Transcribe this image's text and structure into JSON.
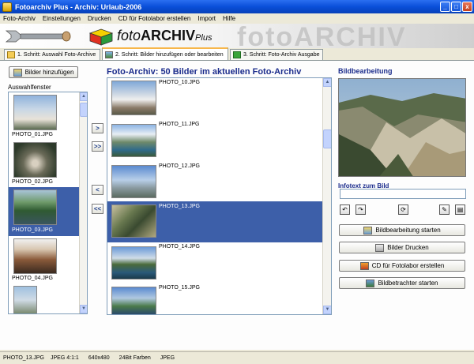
{
  "window": {
    "title": "Fotoarchiv Plus - Archiv: Urlaub-2006",
    "minimize": "_",
    "maximize": "□",
    "close": "x"
  },
  "menu": [
    "Foto-Archiv",
    "Einstellungen",
    "Drucken",
    "CD für Fotolabor erstellen",
    "Import",
    "Hilfe"
  ],
  "banner": {
    "logo_prefix": "foto",
    "logo_main": "ARCHIV",
    "logo_suffix": "Plus",
    "watermark": "fotoARCHIV"
  },
  "tabs": [
    {
      "label": "1. Schritt: Auswahl Foto-Archive",
      "icon": "folder-icon"
    },
    {
      "label": "2. Schritt: Bilder hinzufügen oder bearbeiten",
      "icon": "photo-icon"
    },
    {
      "label": "3. Schritt: Foto-Archiv Ausgabe",
      "icon": "arrow-icon"
    }
  ],
  "left": {
    "add_button": "Bilder hinzufügen",
    "window_label": "Auswahlfenster",
    "items": [
      "PHOTO_01.JPG",
      "PHOTO_02.JPG",
      "PHOTO_03.JPG",
      "PHOTO_04.JPG"
    ]
  },
  "nav": {
    "add_one": ">",
    "add_all": ">>",
    "remove_one": "<",
    "remove_all": "<<"
  },
  "center": {
    "headline": "Foto-Archiv: 50 Bilder im aktuellen Foto-Archiv",
    "items": [
      "PHOTO_10.JPG",
      "PHOTO_11.JPG",
      "PHOTO_12.JPG",
      "PHOTO_13.JPG",
      "PHOTO_14.JPG",
      "PHOTO_15.JPG"
    ]
  },
  "right": {
    "title": "Bildbearbeitung",
    "info_title": "Infotext zum Bild",
    "tools": [
      "↶",
      "↷",
      "⟳",
      "✎",
      "▤"
    ],
    "buttons": [
      "Bildbearbeitung starten",
      "Bilder Drucken",
      "CD für Fotolabor erstellen",
      "Bildbetrachter starten"
    ]
  },
  "status": [
    "PHOTO_13.JPG",
    "JPEG 4:1:1",
    "640x480",
    "24Bit Farben",
    "JPEG"
  ],
  "colors": {
    "selection": "#3d5fa9",
    "heading": "#1b2c8c",
    "titlebar": "#0a4fd9"
  }
}
